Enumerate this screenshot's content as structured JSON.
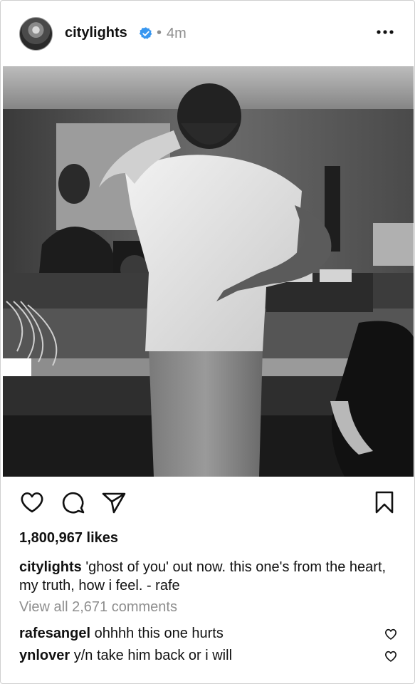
{
  "post": {
    "username": "citylights",
    "separator": "•",
    "time": "4m"
  },
  "actions": {
    "like_icon": "heart-icon",
    "comment_icon": "comment-icon",
    "share_icon": "send-icon",
    "save_icon": "bookmark-icon"
  },
  "likes": "1,800,967 likes",
  "caption": {
    "username": "citylights",
    "text": "'ghost of you' out now. this one's from the heart, my truth, how i feel. - rafe"
  },
  "view_all": "View all 2,671 comments",
  "comments": [
    {
      "username": "rafesangel",
      "text": "ohhhh this one hurts"
    },
    {
      "username": "ynlover",
      "text": "y/n take him back or i will"
    }
  ],
  "colors": {
    "verified": "#3897f0",
    "muted": "#8e8e8e",
    "text": "#111111"
  }
}
